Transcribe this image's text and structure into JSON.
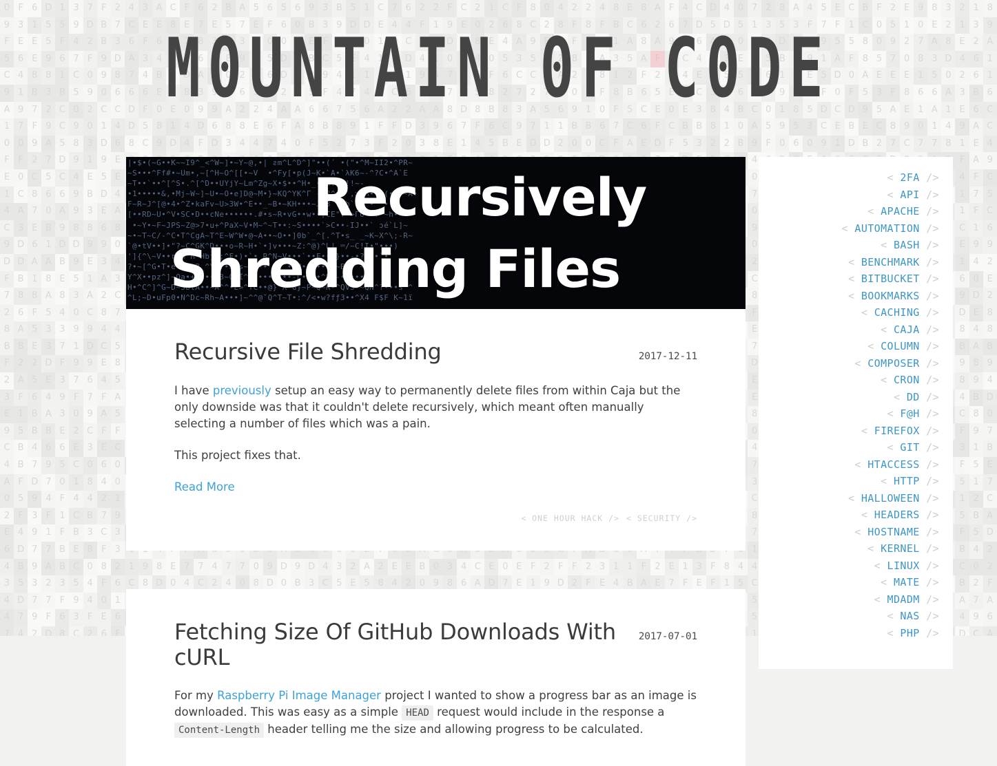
{
  "site": {
    "title": "M0UNTAIN 0F C0DE",
    "title_plain": "Mountain of Code"
  },
  "hero": {
    "line1": "Recursively",
    "line2": "Shredding Files",
    "noise": "|•$•(~G••K~~I9^_<^W~]•~Y~@,•| ᴤm^L^D^]\"••(´ •(\"•^M~II2•^PR~\n~S•••^Ff#•~Um•,~[^H~O^[[•~V  •^Fy[•p(J~K•`A•`λK6~-^?C•^A`Е\n~T••`••^[^S•.^[^D••UYjY~Lm^Zg~X•$••^H•_••%.7^!!~-\n•1•••••&,•Mj~W~]~U•~O•e]D@~M•}~KQ^YK^Γ -!?^xh`,>^Λ•••(••,~A•\nF~R~J^[@•4•^Z•kaFv~U>3W•^E••_~B•~KH•••~J.З`V^b` L^•` •••\n[••RD~U•^V•SC•D••cNe••••••.#•s~R•vG••w••;CE\".^>ГU~-!`~h•\n •~Y•~F~JPS~Z@>7•u+^PaX~V•M~^~T••:~S••••`>C••-IJ••` ɔé`L]~\n~•~T~C/-^C•T^CgA~T^E~W^W•@~A••~O••]0b`_^[.^T•ѕ_ _~K~X^\\;-R~\n`@•tV••]•\"?~C^GK^D•••o~R~H•`•]v•••~Z:^@)^L| ⌨/~C!I•\"•••)\n']{^\\~V••r~M^H~Hbƒ3;^F•)•`• R^N~V•••`••F••`}••-•?•••`•`\n?•~[^G•T•e•^A•B_^Ykf•hls~CC••`•V`••H•••••••~B • ~•`\nY^X••pz^]~Oa•+•d•••3~Q•Ï^`••••••••-L••••^N~-•••••• \nH•^C^]^G~D~SblA••~A^^•E>^TC••@}^X^G}~P~Q~K•^QV3•~QN^?•••ѕ ^\n^L;~D•uFp0•N^Dc~Rh~A•••]~^^@ˇQ^T~T•:^/<•w?fƒ3••^X4 F$F K~1ï"
  },
  "posts": [
    {
      "title": "Recursive File Shredding",
      "date": "2017-12-11",
      "paragraphs": [
        {
          "parts": [
            {
              "type": "text",
              "value": "I have "
            },
            {
              "type": "link",
              "value": "previously"
            },
            {
              "type": "text",
              "value": " setup an easy way to permanently delete files from within Caja but the only downside was that it couldn't delete recursively, which meant often manually selecting a number of files which was a pain."
            }
          ]
        },
        {
          "parts": [
            {
              "type": "text",
              "value": "This project fixes that."
            }
          ]
        }
      ],
      "read_more": "Read More",
      "tags": [
        "ONE HOUR HACK",
        "SECURITY"
      ]
    },
    {
      "title": "Fetching Size Of GitHub Downloads With cURL",
      "date": "2017-07-01",
      "paragraphs": [
        {
          "parts": [
            {
              "type": "text",
              "value": "For my "
            },
            {
              "type": "link",
              "value": "Raspberry Pi Image Manager"
            },
            {
              "type": "text",
              "value": " project I wanted to show a progress bar as an image is downloaded. This was easy as a simple "
            },
            {
              "type": "code",
              "value": "HEAD"
            },
            {
              "type": "text",
              "value": " request would include in the response a "
            },
            {
              "type": "code",
              "value": "Content-Length"
            },
            {
              "type": "text",
              "value": " header telling me the size and allowing progress to be calculated."
            }
          ]
        }
      ],
      "read_more": "",
      "tags": []
    }
  ],
  "sidebar": {
    "tag_open": "<",
    "tag_close": "/>",
    "tags": [
      "2FA",
      "API",
      "APACHE",
      "AUTOMATION",
      "BASH",
      "BENCHMARK",
      "BITBUCKET",
      "BOOKMARKS",
      "CACHING",
      "CAJA",
      "COLUMN",
      "COMPOSER",
      "CRON",
      "DD",
      "F@H",
      "FIREFOX",
      "GIT",
      "HTACCESS",
      "HTTP",
      "HALLOWEEN",
      "HEADERS",
      "HOSTNAME",
      "KERNEL",
      "LINUX",
      "MATE",
      "MDADM",
      "NAS",
      "PHP"
    ]
  },
  "colors": {
    "accent_link": "#3ea2d8",
    "sidebar_tag": "#3e96c6",
    "bracket": "#cdcdcd",
    "title": "#444444",
    "hero_bg": "#05060a",
    "page_bg": "#f4f4f3",
    "hex_char": "#d9d9d7",
    "highlight_cell": "#f2d0d3"
  },
  "background": {
    "hex_chars": "0123456789ABCDEF"
  }
}
